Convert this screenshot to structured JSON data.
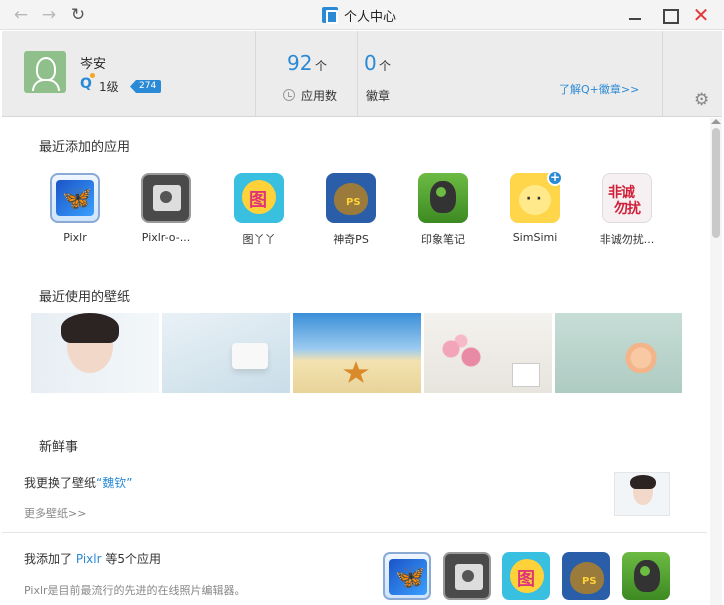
{
  "window": {
    "title": "个人中心",
    "back_glyph": "←",
    "forward_glyph": "→",
    "reload_glyph": "↻",
    "close_glyph": "✕"
  },
  "profile": {
    "name": "岑安",
    "level_text": "1级",
    "level_badge": "274"
  },
  "stats": {
    "apps_count": "92",
    "apps_unit": "个",
    "apps_label": "应用数",
    "badges_count": "0",
    "badges_unit": "个",
    "badges_label": "徽章",
    "learn_more": "了解Q+徽章>>"
  },
  "recent_apps": {
    "title": "最近添加的应用",
    "items": [
      {
        "label": "Pixlr",
        "icon": "pixlr-icon"
      },
      {
        "label": "Pixlr-o-...",
        "icon": "pixlr-o-matic-icon"
      },
      {
        "label": "图丫丫",
        "icon": "tuyaya-icon"
      },
      {
        "label": "神奇PS",
        "icon": "shenqi-ps-icon"
      },
      {
        "label": "印象笔记",
        "icon": "evernote-icon"
      },
      {
        "label": "SimSimi",
        "icon": "simsimi-icon"
      },
      {
        "label": "非诚勿扰...",
        "icon": "feicheng-wurao-icon"
      }
    ]
  },
  "recent_wallpapers": {
    "title": "最近使用的壁纸"
  },
  "news": {
    "title": "新鲜事",
    "wallpaper_prefix": "我更换了壁纸",
    "wallpaper_name": "“魏钦”",
    "more_wallpapers": "更多壁纸>>",
    "added_prefix": "我添加了",
    "added_app": "Pixlr",
    "added_suffix": "等5个应用",
    "description": "Pixlr是目前最流行的先进的在线照片编辑器。"
  },
  "colors": {
    "accent": "#2b8ad6",
    "close": "#e23a3a"
  }
}
